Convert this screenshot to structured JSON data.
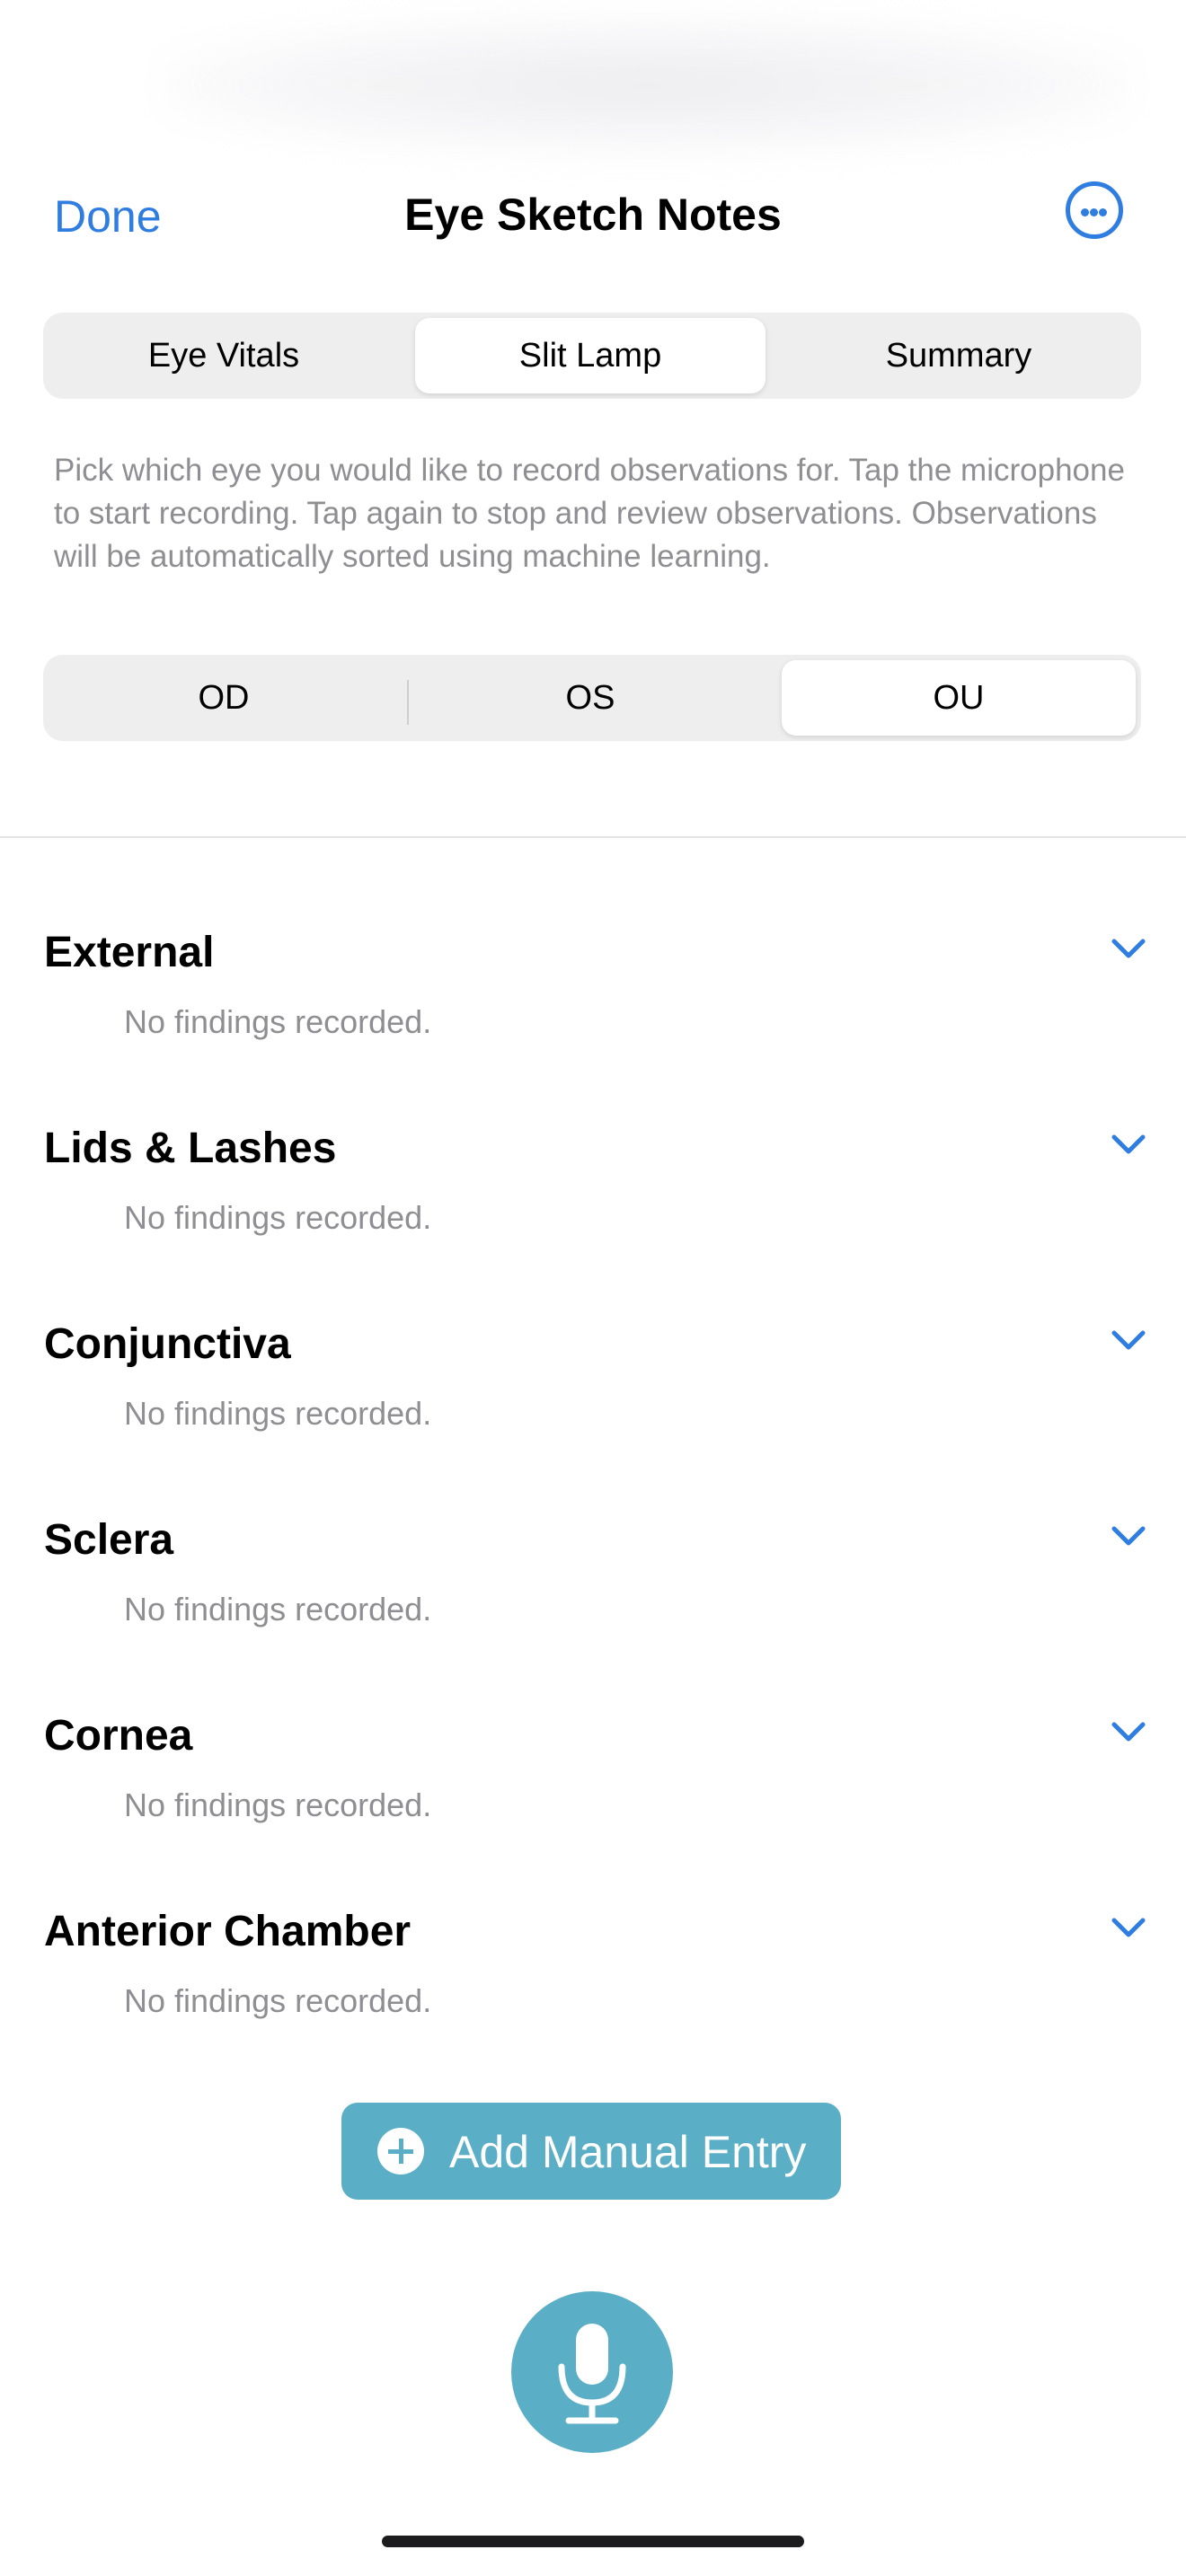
{
  "nav": {
    "done_label": "Done",
    "title": "Eye Sketch Notes",
    "more_icon": "ellipsis-circle-icon"
  },
  "tabs": {
    "items": [
      {
        "label": "Eye Vitals",
        "selected": false
      },
      {
        "label": "Slit Lamp",
        "selected": true
      },
      {
        "label": "Summary",
        "selected": false
      }
    ]
  },
  "instructions": "Pick which eye you would like to record observations for. Tap the microphone to start recording. Tap again to stop and review observations. Observations will be automatically sorted using machine learning.",
  "eye_selector": {
    "items": [
      {
        "label": "OD",
        "selected": false
      },
      {
        "label": "OS",
        "selected": false
      },
      {
        "label": "OU",
        "selected": true
      }
    ]
  },
  "sections": [
    {
      "title": "External",
      "empty_text": "No findings recorded."
    },
    {
      "title": "Lids & Lashes",
      "empty_text": "No findings recorded."
    },
    {
      "title": "Conjunctiva",
      "empty_text": "No findings recorded."
    },
    {
      "title": "Sclera",
      "empty_text": "No findings recorded."
    },
    {
      "title": "Cornea",
      "empty_text": "No findings recorded."
    },
    {
      "title": "Anterior Chamber",
      "empty_text": "No findings recorded."
    }
  ],
  "add_manual_entry": {
    "label": "Add Manual Entry",
    "icon": "plus-circle-icon"
  },
  "mic_button": {
    "icon": "microphone-icon"
  },
  "colors": {
    "accent": "#2f7de1",
    "teal": "#5aaec6",
    "secondary_text": "#8e8e93",
    "segment_bg": "#eeeeef"
  }
}
